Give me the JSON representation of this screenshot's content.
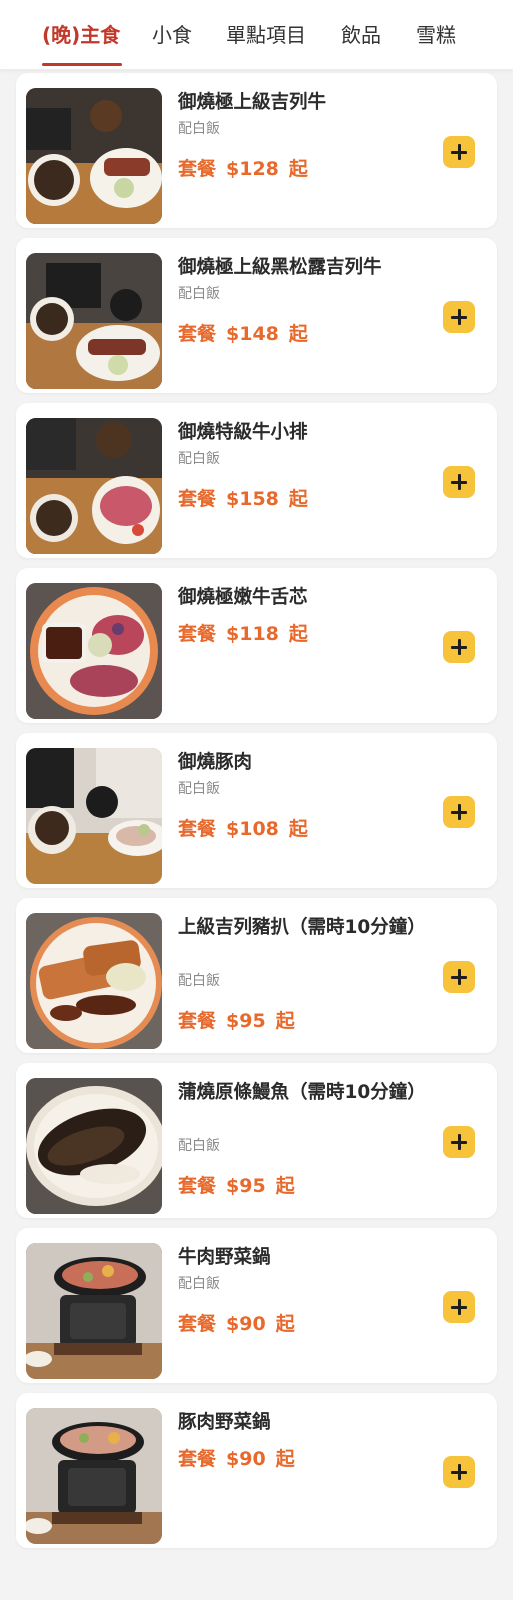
{
  "tabs": [
    {
      "label": "(晚)主食",
      "active": true
    },
    {
      "label": "小食"
    },
    {
      "label": "單點項目"
    },
    {
      "label": "飲品"
    },
    {
      "label": "雪糕"
    }
  ],
  "colors": {
    "accent": "#c0392b",
    "price": "#e8692c",
    "add_button": "#f7c33a"
  },
  "items": [
    {
      "name": "御燒極上級吉列牛",
      "sub": "配白飯",
      "price_label": "套餐",
      "price": "$128",
      "suffix": "起",
      "icon": "plus-icon"
    },
    {
      "name": "御燒極上級黑松露吉列牛",
      "sub": "配白飯",
      "price_label": "套餐",
      "price": "$148",
      "suffix": "起",
      "icon": "plus-icon"
    },
    {
      "name": "御燒特級牛小排",
      "sub": "配白飯",
      "price_label": "套餐",
      "price": "$158",
      "suffix": "起",
      "icon": "plus-icon"
    },
    {
      "name": "御燒極嫩牛舌芯",
      "sub": "",
      "price_label": "套餐",
      "price": "$118",
      "suffix": "起",
      "icon": "plus-icon"
    },
    {
      "name": "御燒豚肉",
      "sub": "配白飯",
      "price_label": "套餐",
      "price": "$108",
      "suffix": "起",
      "icon": "plus-icon"
    },
    {
      "name": "上級吉列豬扒（需時10分鐘）",
      "sub": "配白飯",
      "price_label": "套餐",
      "price": "$95",
      "suffix": "起",
      "icon": "plus-icon"
    },
    {
      "name": "蒲燒原條鰻魚（需時10分鐘）",
      "sub": "配白飯",
      "price_label": "套餐",
      "price": "$95",
      "suffix": "起",
      "icon": "plus-icon"
    },
    {
      "name": "牛肉野菜鍋",
      "sub": "配白飯",
      "price_label": "套餐",
      "price": "$90",
      "suffix": "起",
      "icon": "plus-icon"
    },
    {
      "name": "豚肉野菜鍋",
      "sub": "",
      "price_label": "套餐",
      "price": "$90",
      "suffix": "起",
      "icon": "plus-icon"
    }
  ]
}
